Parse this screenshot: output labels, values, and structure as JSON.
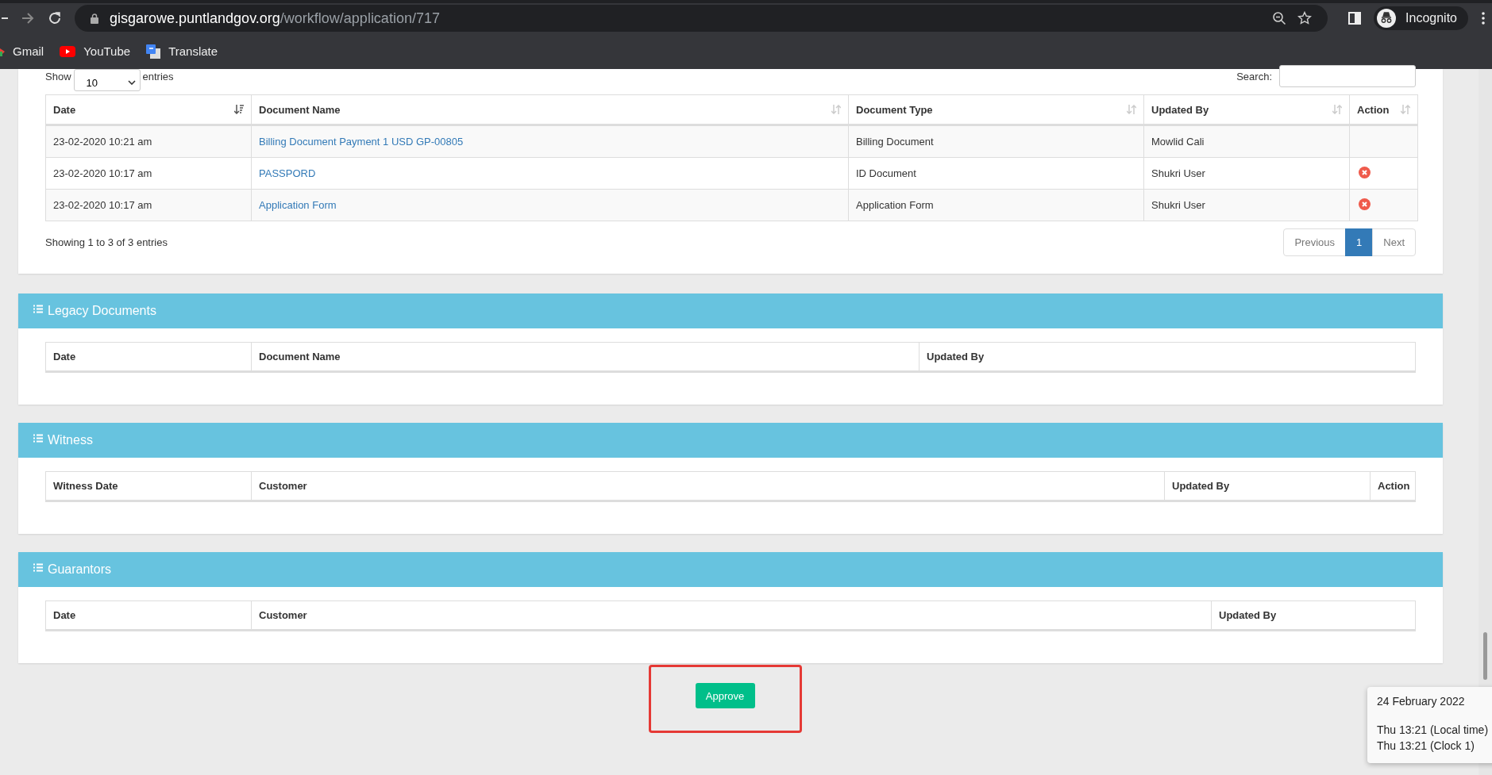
{
  "browser": {
    "url_host": "gisgarowe.puntlandgov.org",
    "url_path": "/workflow/application/717",
    "profile_label": "Incognito",
    "bookmarks": [
      {
        "label": "Gmail",
        "kind": "gmail"
      },
      {
        "label": "YouTube",
        "kind": "youtube"
      },
      {
        "label": "Translate",
        "kind": "translate"
      }
    ]
  },
  "documents": {
    "show_label": "Show",
    "page_length": "10",
    "entries_label": "entries",
    "search_label": "Search:",
    "columns": [
      {
        "label": "Date",
        "sorted": true
      },
      {
        "label": "Document Name",
        "sorted": false
      },
      {
        "label": "Document Type",
        "sorted": false
      },
      {
        "label": "Updated By",
        "sorted": false
      },
      {
        "label": "Action",
        "sorted": false
      }
    ],
    "rows": [
      {
        "date": "23-02-2020 10:21 am",
        "document_name": "Billing Document Payment 1 USD GP-00805",
        "document_type": "Billing Document",
        "updated_by": "Mowlid Cali",
        "removable": false
      },
      {
        "date": "23-02-2020 10:17 am",
        "document_name": "PASSPORD",
        "document_type": "ID Document",
        "updated_by": "Shukri User",
        "removable": true
      },
      {
        "date": "23-02-2020 10:17 am",
        "document_name": "Application Form",
        "document_type": "Application Form",
        "updated_by": "Shukri User",
        "removable": true
      }
    ],
    "info": "Showing 1 to 3 of 3 entries",
    "pagination": {
      "previous": "Previous",
      "pages": [
        {
          "label": "1",
          "selected": true
        }
      ],
      "next": "Next"
    }
  },
  "panels": [
    {
      "title": "Legacy Documents",
      "columns": [
        "Date",
        "Document Name",
        "Updated By"
      ]
    },
    {
      "title": "Witness",
      "columns": [
        "Witness Date",
        "Customer",
        "Updated By",
        "Action"
      ]
    },
    {
      "title": "Guarantors",
      "columns": [
        "Date",
        "Customer",
        "Updated By"
      ]
    }
  ],
  "approve_button": "Approve",
  "clock_tooltip": {
    "date": "24 February 2022",
    "lines": [
      "Thu 13:21 (Local time)",
      "Thu 13:21 (Clock 1)"
    ]
  }
}
